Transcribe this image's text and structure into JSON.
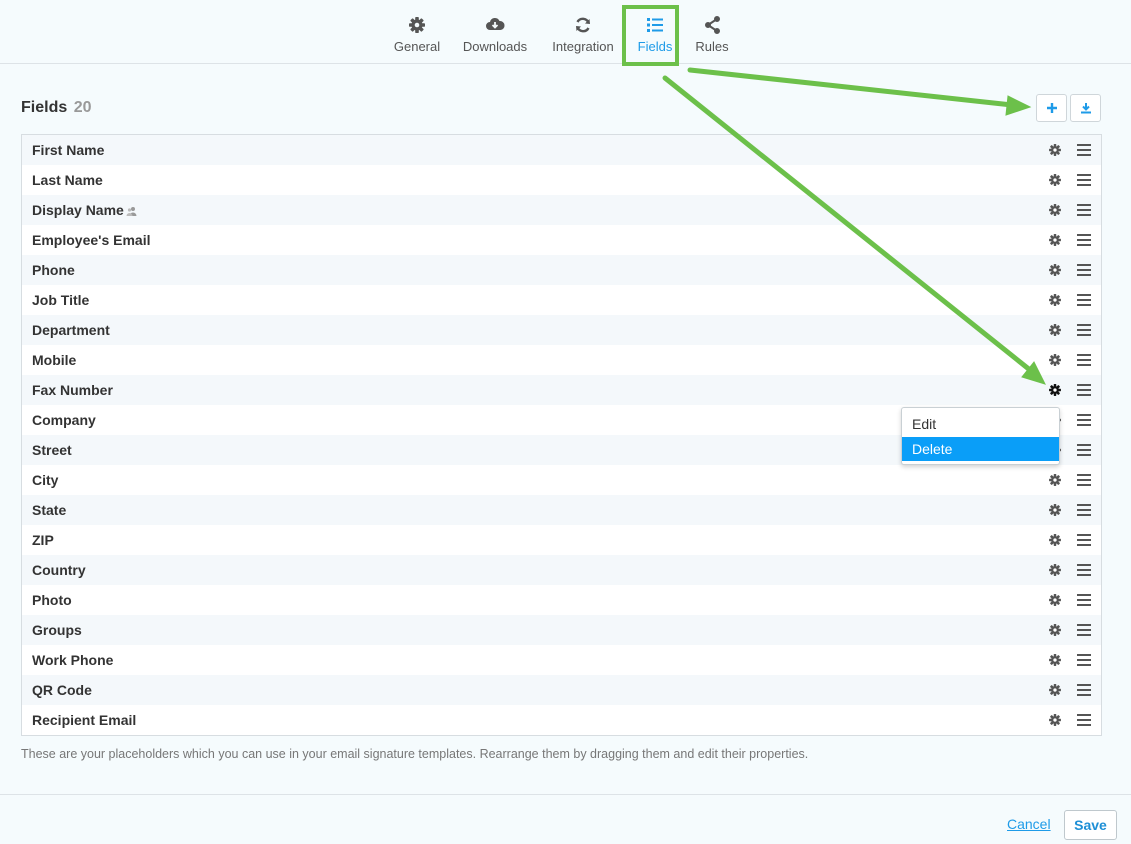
{
  "tabs": [
    {
      "label": "General",
      "icon": "gear-icon"
    },
    {
      "label": "Downloads",
      "icon": "cloud-download-icon"
    },
    {
      "label": "Integration",
      "icon": "sync-icon"
    },
    {
      "label": "Fields",
      "icon": "list-icon",
      "active": true
    },
    {
      "label": "Rules",
      "icon": "share-icon"
    }
  ],
  "heading": {
    "title": "Fields",
    "count": "20"
  },
  "toolbar": {
    "add_icon": "plus-icon",
    "download_icon": "download-icon"
  },
  "fields": [
    {
      "label": "First Name"
    },
    {
      "label": "Last Name"
    },
    {
      "label": "Display Name",
      "icon": "users-icon"
    },
    {
      "label": "Employee's Email"
    },
    {
      "label": "Phone"
    },
    {
      "label": "Job Title"
    },
    {
      "label": "Department"
    },
    {
      "label": "Mobile"
    },
    {
      "label": "Fax Number"
    },
    {
      "label": "Company"
    },
    {
      "label": "Street"
    },
    {
      "label": "City"
    },
    {
      "label": "State"
    },
    {
      "label": "ZIP"
    },
    {
      "label": "Country"
    },
    {
      "label": "Photo"
    },
    {
      "label": "Groups"
    },
    {
      "label": "Work Phone"
    },
    {
      "label": "QR Code"
    },
    {
      "label": "Recipient Email"
    }
  ],
  "context_menu": {
    "items": [
      "Edit",
      "Delete"
    ],
    "selected": "Delete"
  },
  "help_text": "These are your placeholders which you can use in your email signature templates. Rearrange them by dragging them and edit their properties.",
  "footer": {
    "cancel": "Cancel",
    "save": "Save"
  },
  "colors": {
    "accent": "#1e9be8",
    "annotation": "#6cc04a",
    "menu_selected": "#0a9ef8"
  }
}
